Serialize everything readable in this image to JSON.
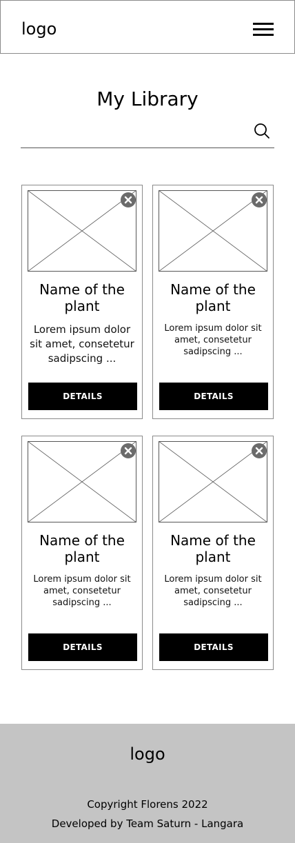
{
  "header": {
    "logo": "logo",
    "menu_icon": "hamburger-menu-icon"
  },
  "main": {
    "title": "My Library",
    "search": {
      "placeholder": "",
      "value": "",
      "icon": "search-icon"
    }
  },
  "cards": [
    {
      "title": "Name of the plant",
      "description": "Lorem ipsum dolor sit amet, consetetur sadipscing ...",
      "button_label": "DETAILS",
      "remove_icon": "close-circle-icon"
    },
    {
      "title": "Name of the plant",
      "description": "Lorem ipsum dolor sit amet, consetetur sadipscing ...",
      "button_label": "DETAILS",
      "remove_icon": "close-circle-icon"
    },
    {
      "title": "Name of the plant",
      "description": "Lorem ipsum dolor sit amet, consetetur sadipscing ...",
      "button_label": "DETAILS",
      "remove_icon": "close-circle-icon"
    },
    {
      "title": "Name of the plant",
      "description": "Lorem ipsum dolor sit amet, consetetur sadipscing ...",
      "button_label": "DETAILS",
      "remove_icon": "close-circle-icon"
    }
  ],
  "footer": {
    "logo": "logo",
    "copyright": "Copyright Florens 2022",
    "developer": "Developed by Team Saturn - Langara"
  },
  "colors": {
    "footer_bg": "#c4c4c4",
    "button_bg": "#000000",
    "button_text": "#ffffff",
    "border": "#8a8a8a"
  }
}
